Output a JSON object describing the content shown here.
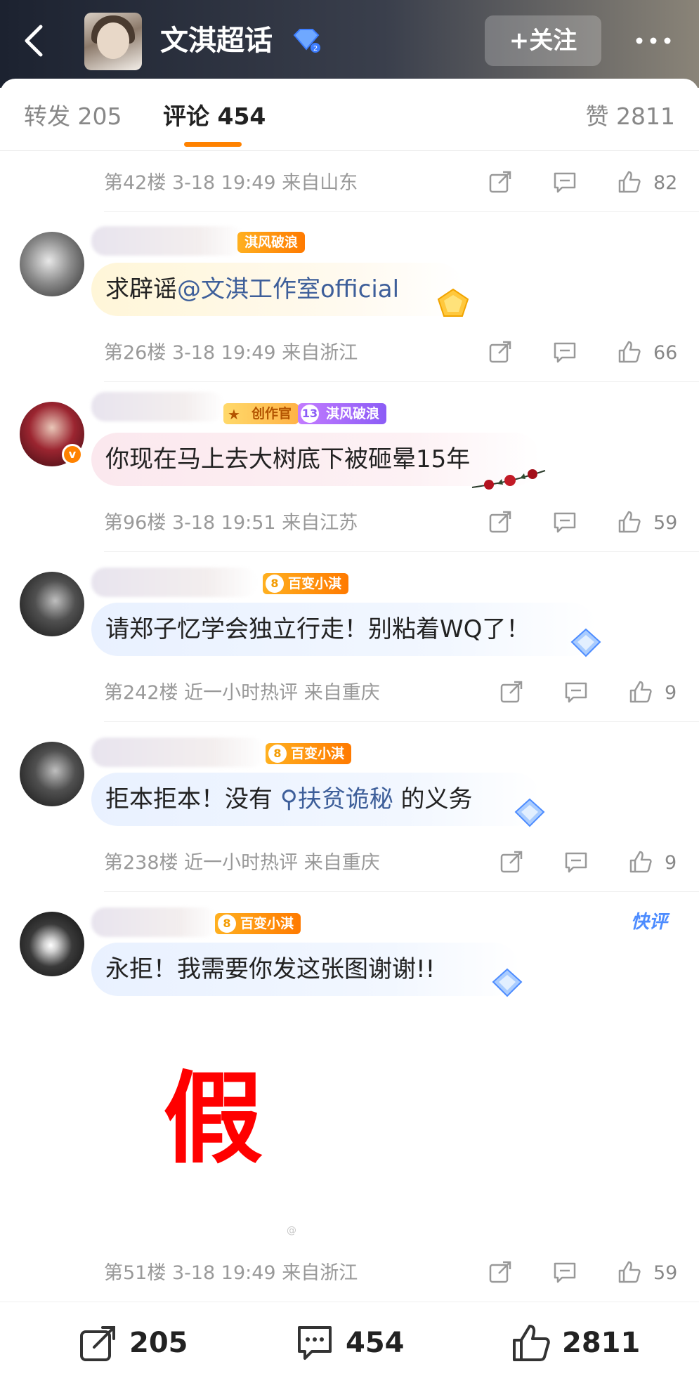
{
  "header": {
    "title": "文淇超话",
    "follow_label": "+关注"
  },
  "tabs": {
    "repost": "转发 205",
    "comment": "评论 454",
    "like": "赞 2811"
  },
  "comments": [
    {
      "meta": "第42楼  3-18 19:49  来自山东",
      "likes": "82"
    },
    {
      "badges": [
        "淇风破浪"
      ],
      "text": "求辟谣",
      "mention": "@文淇工作室official",
      "meta": "第26楼  3-18 19:49  来自浙江",
      "likes": "66"
    },
    {
      "badges": [
        "创作官",
        "淇风破浪"
      ],
      "badge_level": "13",
      "text": "你现在马上去大树底下被砸晕15年",
      "meta": "第96楼  3-18 19:51  来自江苏",
      "likes": "59"
    },
    {
      "badges": [
        "百变小淇"
      ],
      "badge_level": "8",
      "text": "请郑子忆学会独立行走！别粘着WQ了！",
      "meta": "第242楼  近一小时热评  来自重庆",
      "likes": "9"
    },
    {
      "badges": [
        "百变小淇"
      ],
      "badge_level": "8",
      "text_before": "拒本拒本！没有",
      "topic": "扶贫诡秘",
      "text_after": "的义务",
      "meta": "第238楼  近一小时热评  来自重庆",
      "likes": "9"
    },
    {
      "badges": [
        "百变小淇"
      ],
      "badge_level": "8",
      "text": "永拒！我需要你发这张图谢谢!!",
      "quick_review": "快评",
      "overlay_mark": "假",
      "meta": "第51楼  3-18 19:49  来自浙江",
      "likes": "59"
    }
  ],
  "bottom_bar": {
    "repost_count": "205",
    "comment_count": "454",
    "like_count": "2811"
  }
}
